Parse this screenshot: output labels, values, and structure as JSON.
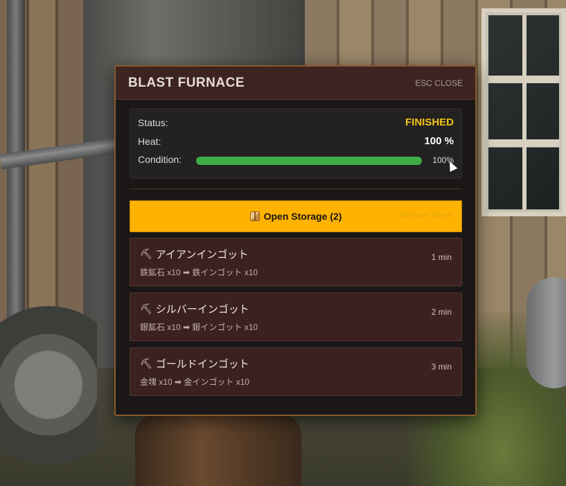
{
  "panel": {
    "title": "BLAST FURNACE",
    "close_label": "ESC CLOSE"
  },
  "status": {
    "status_label": "Status:",
    "status_value": "FINISHED",
    "heat_label": "Heat:",
    "heat_value": "100 %",
    "condition_label": "Condition:",
    "condition_value": "100%",
    "condition_fraction": 1.0
  },
  "storage": {
    "button_label": "Open Storage (2)",
    "retrieve_label": "Retrieve Items"
  },
  "recipes": [
    {
      "name": "アイアンインゴット",
      "io": "鉄鉱石 x10 ➡ 鉄インゴット x10",
      "time": "1 min"
    },
    {
      "name": "シルバーインゴット",
      "io": "銀鉱石 x10 ➡ 銀インゴット x10",
      "time": "2 min"
    },
    {
      "name": "ゴールドインゴット",
      "io": "金塊 x10 ➡ 金インゴット x10",
      "time": "3 min"
    }
  ],
  "icons": {
    "storage": "box-icon",
    "recipe": "pickaxe-icon"
  },
  "colors": {
    "accent": "#ffb300",
    "status_finished": "#f2c318",
    "condition_bar": "#3fad45",
    "header_bg": "#3d2421",
    "recipe_bg": "#3b2220"
  }
}
